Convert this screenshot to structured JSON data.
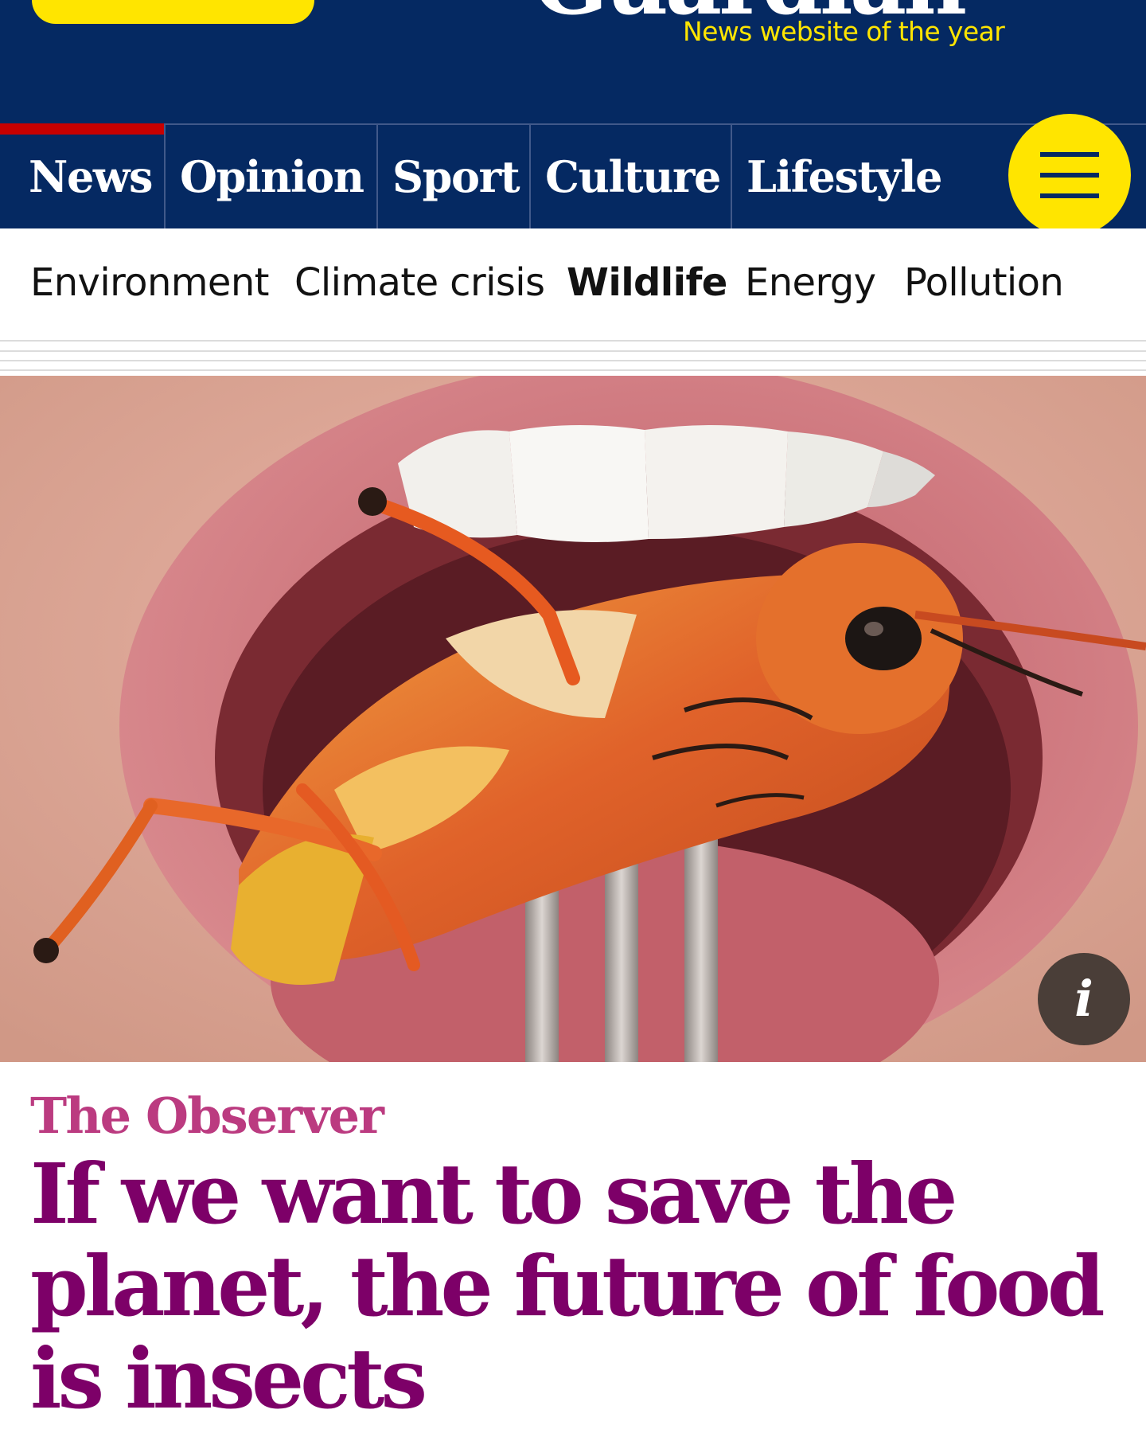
{
  "masthead": {
    "logo_text": "Guardian",
    "tagline": "News website of the year"
  },
  "nav": {
    "pillars": [
      {
        "label": "News"
      },
      {
        "label": "Opinion"
      },
      {
        "label": "Sport"
      },
      {
        "label": "Culture"
      },
      {
        "label": "Lifestyle"
      }
    ],
    "menu_icon": "hamburger-icon"
  },
  "subnav": {
    "items": [
      {
        "label": "Environment"
      },
      {
        "label": "Climate crisis"
      },
      {
        "label": "Wildlife"
      },
      {
        "label": "Energy"
      },
      {
        "label": "Pollution"
      }
    ]
  },
  "hero": {
    "info_label": "i"
  },
  "article": {
    "series": "The Observer",
    "headline": "If we want to save the planet, the future of food is insects"
  },
  "colors": {
    "brand_blue": "#052962",
    "brand_yellow": "#ffe500",
    "headline_purple": "#7d0068",
    "series_pink": "#bb3b80",
    "active_pillar_red": "#c70000"
  }
}
